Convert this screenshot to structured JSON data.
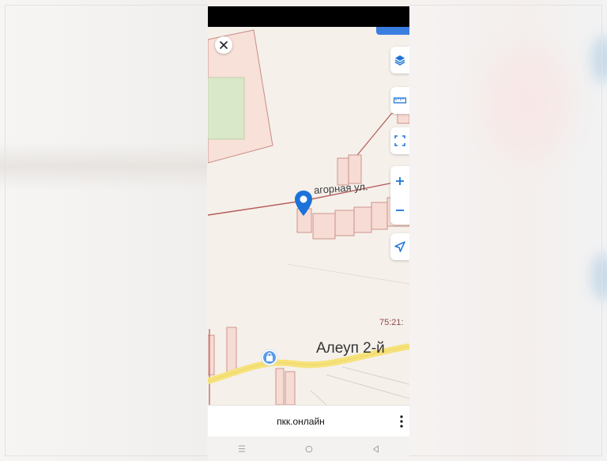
{
  "map": {
    "street_label": "агорная ул.",
    "cadastral_number": "75:21:",
    "district_label": "Алеуп 2-й"
  },
  "browser": {
    "url": "пкк.онлайн"
  },
  "icons": {
    "close": "close-icon",
    "layers": "layers-icon",
    "ruler": "ruler-icon",
    "fullscreen": "fullscreen-icon",
    "zoom_in": "plus-icon",
    "zoom_out": "minus-icon",
    "locate": "navigation-arrow-icon",
    "marker": "map-pin-icon",
    "shop": "shopping-bag-icon",
    "menu": "more-vertical-icon",
    "nav_recents": "recents-icon",
    "nav_home": "home-icon",
    "nav_back": "back-icon"
  },
  "colors": {
    "accent": "#1c72d8",
    "road_yellow": "#f6e27a",
    "parcel_fill": "#f6dcd4",
    "parcel_stroke": "#c98c86",
    "field_green": "#d9e8c8"
  }
}
